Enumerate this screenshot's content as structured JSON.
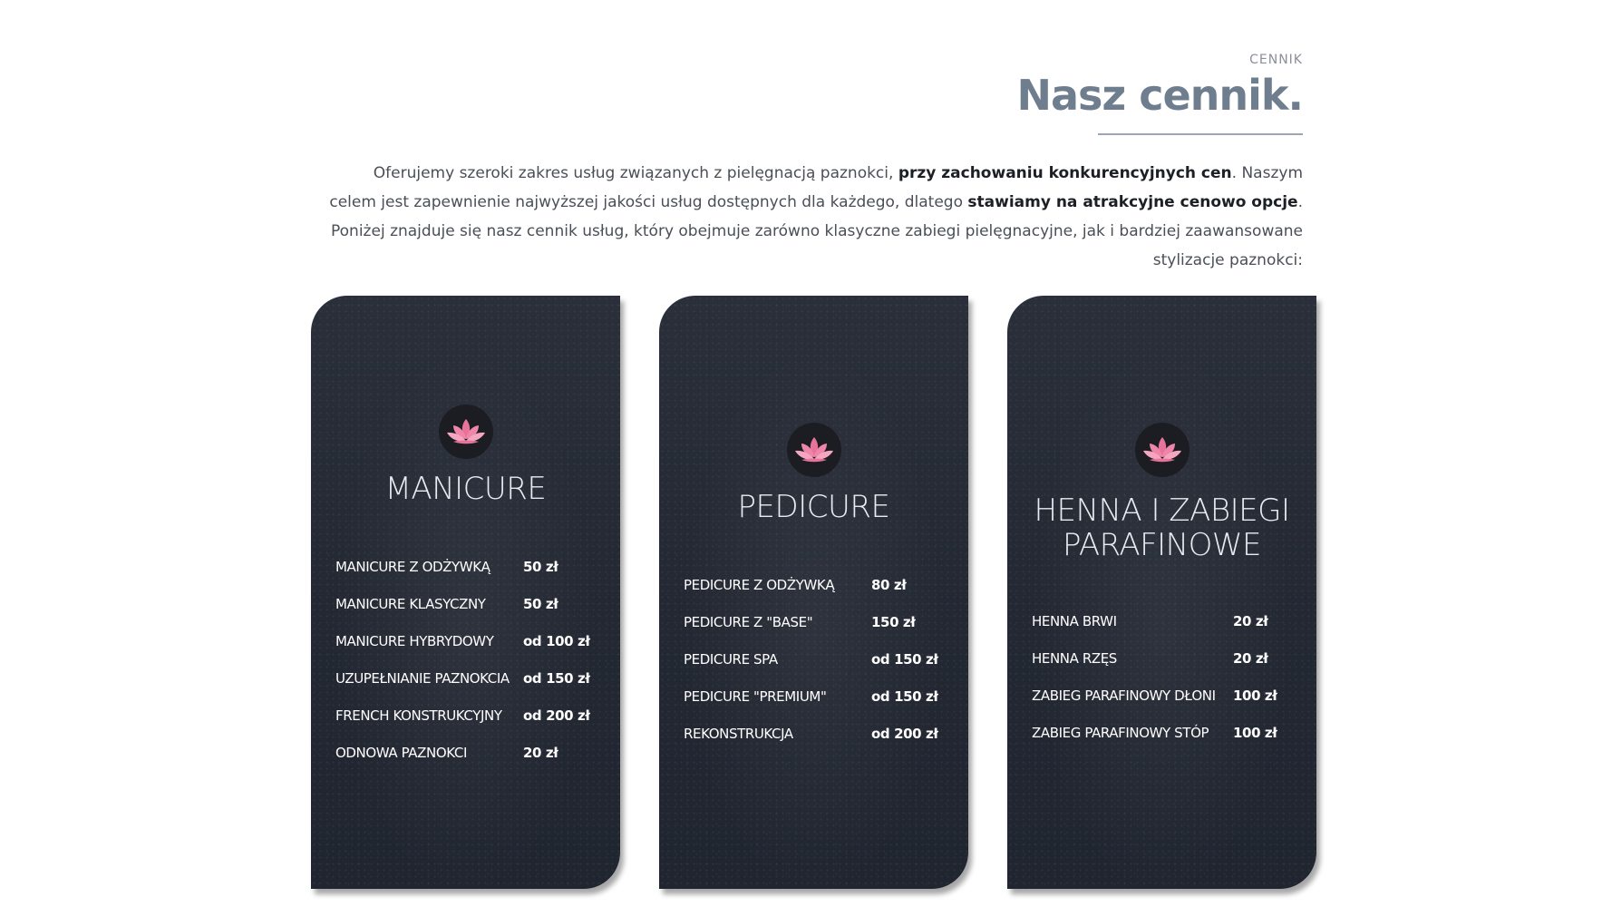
{
  "header": {
    "eyebrow": "CENNIK",
    "title": "Nasz cennik.",
    "intro_1": "Oferujemy szeroki zakres usług związanych z pielęgnacją paznokci, ",
    "intro_bold_1": "przy zachowaniu konkurencyjnych cen",
    "intro_2": ". Naszym celem jest zapewnienie najwyższej jakości usług dostępnych dla każdego, dlatego ",
    "intro_bold_2": "stawiamy na atrakcyjne cenowo opcje",
    "intro_3": ". Poniżej znajduje się nasz cennik usług, który obejmuje zarówno klasyczne zabiegi pielęgnacyjne, jak i bardziej zaawansowane stylizacje paznokci:"
  },
  "colors": {
    "title": "#6f7e8f",
    "card_bg": "#252a34",
    "lotus_pink": "#e8739a",
    "lotus_light": "#f4a6c0"
  },
  "cards": [
    {
      "icon": "lotus-icon",
      "title": "MANICURE",
      "items": [
        {
          "service": "MANICURE Z ODŻYWKĄ",
          "price": "50 zł"
        },
        {
          "service": "MANICURE KLASYCZNY",
          "price": "50 zł"
        },
        {
          "service": "MANICURE HYBRYDOWY",
          "price": "od 100 zł"
        },
        {
          "service": "UZUPEŁNIANIE PAZNOKCIA",
          "price": "od 150 zł"
        },
        {
          "service": "FRENCH KONSTRUKCYJNY",
          "price": "od 200 zł"
        },
        {
          "service": "ODNOWA PAZNOKCI",
          "price": "20 zł"
        }
      ]
    },
    {
      "icon": "lotus-icon",
      "title": "PEDICURE",
      "items": [
        {
          "service": "PEDICURE Z ODŻYWKĄ",
          "price": "80 zł"
        },
        {
          "service": "PEDICURE Z \"BASE\"",
          "price": "150 zł"
        },
        {
          "service": "PEDICURE SPA",
          "price": "od 150 zł"
        },
        {
          "service": "PEDICURE \"PREMIUM\"",
          "price": "od 150 zł"
        },
        {
          "service": "REKONSTRUKCJA",
          "price": "od 200 zł"
        }
      ]
    },
    {
      "icon": "lotus-icon",
      "title_line_1": "HENNA I ZABIEGI",
      "title_line_2": "PARAFINOWE",
      "items": [
        {
          "service": "HENNA BRWI",
          "price": "20 zł"
        },
        {
          "service": "HENNA RZĘS",
          "price": "20 zł"
        },
        {
          "service": "ZABIEG PARAFINOWY DŁONI",
          "price": "100 zł"
        },
        {
          "service": "ZABIEG PARAFINOWY STÓP",
          "price": "100 zł"
        }
      ]
    }
  ]
}
